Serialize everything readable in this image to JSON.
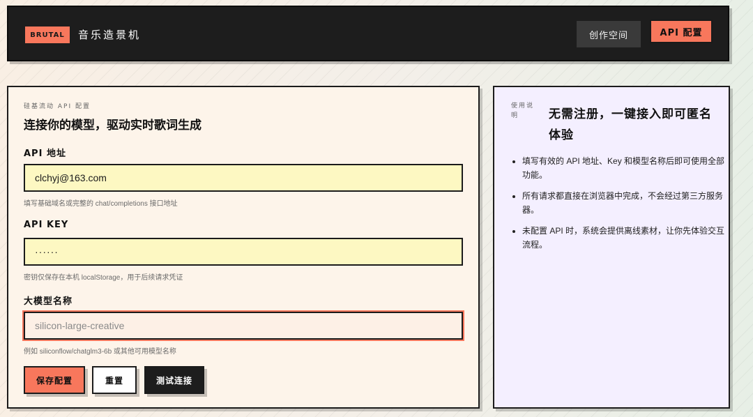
{
  "header": {
    "badge": "BRUTAL",
    "title": "音乐造景机",
    "nav": {
      "workspace": "创作空间",
      "api_config": "API 配置"
    }
  },
  "config": {
    "eyebrow": "硅基流动 API 配置",
    "title": "连接你的模型，驱动实时歌词生成",
    "api_url": {
      "label": "API 地址",
      "value": "clchyj@163.com",
      "hint": "填写基础域名或完整的 chat/completions 接口地址"
    },
    "api_key": {
      "label": "API KEY",
      "value": "······",
      "hint": "密钥仅保存在本机 localStorage，用于后续请求凭证"
    },
    "model": {
      "label": "大模型名称",
      "value": "",
      "placeholder": "silicon-large-creative",
      "hint": "例如 siliconflow/chatglm3-6b 或其他可用模型名称"
    },
    "buttons": {
      "save": "保存配置",
      "reset": "重置",
      "test": "测试连接"
    }
  },
  "instructions": {
    "tag": "使用说明",
    "title": "无需注册，一键接入即可匿名体验",
    "items": [
      "填写有效的 API 地址、Key 和模型名称后即可使用全部功能。",
      "所有请求都直接在浏览器中完成，不会经过第三方服务器。",
      "未配置 API 时，系统会提供离线素材，让你先体验交互流程。"
    ]
  },
  "colors": {
    "accent": "#f8775c",
    "header_bg": "#1d1d1d",
    "input_bg": "#fdf8c2",
    "card_bg": "#fdf4ea",
    "panel_bg": "#f4efff"
  }
}
